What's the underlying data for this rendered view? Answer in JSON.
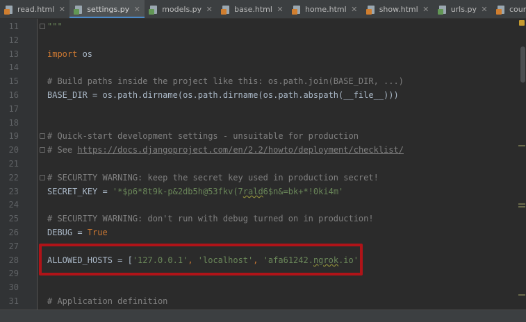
{
  "tabs": [
    {
      "label": "read.html",
      "icon": "html-file-icon",
      "active": false
    },
    {
      "label": "settings.py",
      "icon": "python-file-icon",
      "active": true
    },
    {
      "label": "models.py",
      "icon": "python-file-icon",
      "active": false
    },
    {
      "label": "base.html",
      "icon": "html-file-icon",
      "active": false
    },
    {
      "label": "home.html",
      "icon": "html-file-icon",
      "active": false
    },
    {
      "label": "show.html",
      "icon": "html-file-icon",
      "active": false
    },
    {
      "label": "urls.py",
      "icon": "python-file-icon",
      "active": false
    },
    {
      "label": "coursedetail.html",
      "icon": "html-file-icon",
      "active": false
    }
  ],
  "lines": [
    {
      "n": "11",
      "parts": [
        {
          "t": "\"\"\"",
          "c": "st"
        }
      ]
    },
    {
      "n": "12",
      "parts": []
    },
    {
      "n": "13",
      "parts": [
        {
          "t": "import",
          "c": "kw"
        },
        {
          "t": " os",
          "c": ""
        }
      ]
    },
    {
      "n": "14",
      "parts": []
    },
    {
      "n": "15",
      "parts": [
        {
          "t": "# Build paths inside the project like this: os.path.join(BASE_DIR, ...)",
          "c": "cm"
        }
      ]
    },
    {
      "n": "16",
      "parts": [
        {
          "t": "BASE_DIR = os.path.dirname(os.path.dirname(os.path.abspath(__file__)))",
          "c": ""
        }
      ]
    },
    {
      "n": "17",
      "parts": []
    },
    {
      "n": "18",
      "parts": []
    },
    {
      "n": "19",
      "parts": [
        {
          "t": "# Quick-start development settings - unsuitable for production",
          "c": "cm"
        }
      ]
    },
    {
      "n": "20",
      "parts": [
        {
          "t": "# See ",
          "c": "cm"
        },
        {
          "t": "https://docs.djangoproject.com/en/2.2/howto/deployment/checklist/",
          "c": "link"
        }
      ]
    },
    {
      "n": "21",
      "parts": []
    },
    {
      "n": "22",
      "parts": [
        {
          "t": "# SECURITY WARNING: keep the secret key used in production secret!",
          "c": "cm"
        }
      ]
    },
    {
      "n": "23",
      "parts": [
        {
          "t": "SECRET_KEY = ",
          "c": ""
        },
        {
          "t": "'*$p6*8t9k-p&2db5h@53fkv(7",
          "c": "st"
        },
        {
          "t": "rald",
          "c": "st squig"
        },
        {
          "t": "6$n&=bk+*!0ki4m'",
          "c": "st"
        }
      ]
    },
    {
      "n": "24",
      "parts": []
    },
    {
      "n": "25",
      "parts": [
        {
          "t": "# SECURITY WARNING: don't run with debug turned on in production!",
          "c": "cm"
        }
      ]
    },
    {
      "n": "26",
      "parts": [
        {
          "t": "DEBUG = ",
          "c": ""
        },
        {
          "t": "True",
          "c": "kw"
        }
      ]
    },
    {
      "n": "27",
      "parts": []
    },
    {
      "n": "28",
      "parts": [
        {
          "t": "ALLOWED_HOSTS = [",
          "c": ""
        },
        {
          "t": "'127.0.0.1'",
          "c": "st"
        },
        {
          "t": ", ",
          "c": "kw"
        },
        {
          "t": "'localhost'",
          "c": "st"
        },
        {
          "t": ", ",
          "c": "kw"
        },
        {
          "t": "'afa61242.",
          "c": "st"
        },
        {
          "t": "ngrok",
          "c": "st squig"
        },
        {
          "t": ".io'",
          "c": "st"
        },
        {
          "t": "]",
          "c": ""
        }
      ]
    },
    {
      "n": "29",
      "parts": []
    },
    {
      "n": "30",
      "parts": []
    },
    {
      "n": "31",
      "parts": [
        {
          "t": "# Application definition",
          "c": "cm"
        }
      ]
    }
  ],
  "fold_lines": [
    "11",
    "19",
    "20",
    "22"
  ],
  "colors": {
    "keyword": "#cc7832",
    "comment": "#808080",
    "string": "#6a8759",
    "text": "#a9b7c6",
    "background": "#2b2b2b",
    "highlight_box": "#b01318"
  }
}
